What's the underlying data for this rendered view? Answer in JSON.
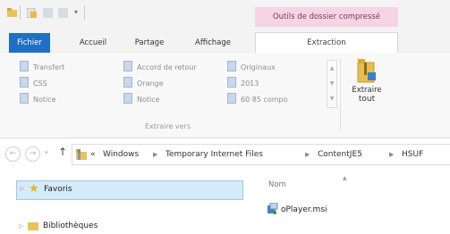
{
  "window": {
    "context_tab_label": "Outils de dossier compressé"
  },
  "ribbon_tabs": [
    {
      "label": "Fichier"
    },
    {
      "label": "Accueil"
    },
    {
      "label": "Partage"
    },
    {
      "label": "Affichage"
    },
    {
      "label": "Extraction"
    }
  ],
  "extract_to": {
    "destinations": [
      "Transfert",
      "Accord de retour",
      "Originaux",
      "CSS",
      "Orange",
      "2013",
      "Notice",
      "Notice",
      "60 85 compo"
    ],
    "group_label": "Extraire vers"
  },
  "extract_all_button": {
    "line1": "Extraire",
    "line2": "tout"
  },
  "address_bar": {
    "overflow": "«",
    "crumbs": [
      "Windows",
      "Temporary Internet Files",
      "ContentJE5",
      "HSUF"
    ]
  },
  "nav_pane": {
    "favorites": "Favoris",
    "libraries": "Bibliothèques"
  },
  "file_list": {
    "column_name": "Nom",
    "items": [
      {
        "name": "oPlayer.msi"
      }
    ]
  },
  "colors": {
    "file_tab": "#1f6fc4",
    "context_tab": "#f6d4e2",
    "selection": "#d6ebf8"
  }
}
